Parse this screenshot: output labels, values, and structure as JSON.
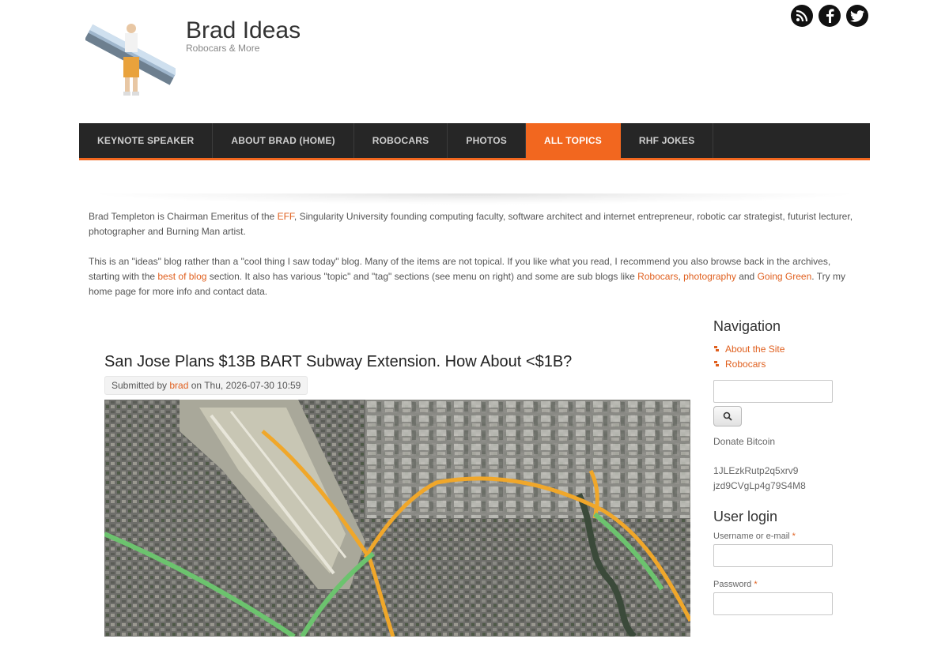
{
  "site": {
    "name": "Brad Ideas",
    "slogan": "Robocars & More"
  },
  "social": [
    "rss-icon",
    "facebook-icon",
    "twitter-icon"
  ],
  "nav": {
    "items": [
      {
        "label": "KEYNOTE SPEAKER"
      },
      {
        "label": "ABOUT BRAD (HOME)"
      },
      {
        "label": "ROBOCARS"
      },
      {
        "label": "PHOTOS"
      },
      {
        "label": "ALL TOPICS",
        "active": true
      },
      {
        "label": "RHF JOKES"
      }
    ]
  },
  "intro": {
    "p1_before": "Brad Templeton is Chairman Emeritus of the ",
    "p1_link": "EFF",
    "p1_after": ", Singularity University founding computing faculty, software architect and internet entrepreneur, robotic car strategist, futurist lecturer, photographer and Burning Man artist.",
    "p2_a": "This is an \"ideas\" blog rather than a \"cool thing I saw today\" blog. Many of the items are not topical. If you like what you read, I recommend you also browse back in the archives, starting with the ",
    "p2_link1": "best of blog",
    "p2_b": " section. It also has various \"topic\" and \"tag\" sections (see menu on right) and some are sub blogs like ",
    "p2_link2": "Robocars",
    "p2_c": ", ",
    "p2_link3": "photography",
    "p2_d": " and ",
    "p2_link4": "Going Green",
    "p2_e": ". Try my home page for more info and contact data."
  },
  "article": {
    "title": "San Jose Plans $13B BART Subway Extension. How About <$1B?",
    "submitted_prefix": "Submitted by ",
    "author": "brad",
    "submitted_suffix": " on Thu, 2026-07-30 10:59"
  },
  "sidebar": {
    "navigation_title": "Navigation",
    "nav_items": [
      "About the Site",
      "Robocars"
    ],
    "donate_label": "Donate Bitcoin",
    "bitcoin_line1": "1JLEzkRutp2q5xrv9",
    "bitcoin_line2": "jzd9CVgLp4g79S4M8",
    "login_title": "User login",
    "username_label": "Username or e-mail",
    "password_label": "Password",
    "required_mark": "*"
  },
  "colors": {
    "accent": "#f2671f",
    "link": "#e0601f",
    "nav_bg": "#262626"
  }
}
